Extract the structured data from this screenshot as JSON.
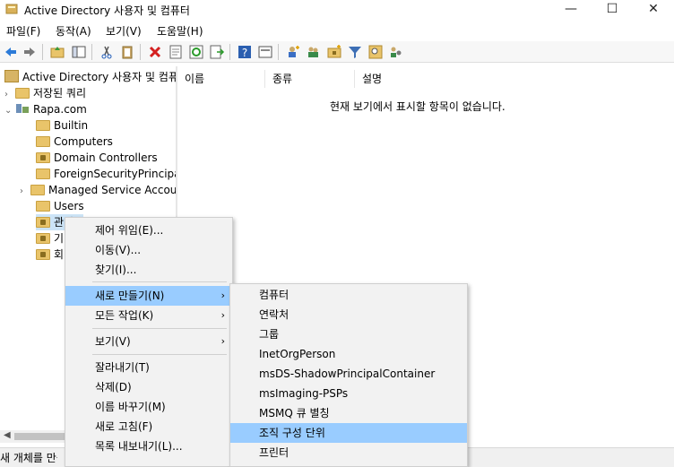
{
  "window": {
    "title": "Active Directory 사용자 및 컴퓨터"
  },
  "menu": [
    "파일(F)",
    "동작(A)",
    "보기(V)",
    "도움말(H)"
  ],
  "tree": {
    "root_label": "Active Directory 사용자 및 컴퓨",
    "saved_queries": "저장된 쿼리",
    "domain": "Rapa.com",
    "children": [
      "Builtin",
      "Computers",
      "Domain Controllers",
      "ForeignSecurityPrincipal",
      "Managed Service Accou",
      "Users",
      "관리부",
      "기",
      "회"
    ]
  },
  "list": {
    "columns": [
      "이름",
      "종류",
      "설명"
    ],
    "empty_message": "현재 보기에서 표시할 항목이 없습니다."
  },
  "context_menu": {
    "items": [
      "제어 위임(E)...",
      "이동(V)...",
      "찾기(I)...",
      "새로 만들기(N)",
      "모든 작업(K)",
      "보기(V)",
      "잘라내기(T)",
      "삭제(D)",
      "이름 바꾸기(M)",
      "새로 고침(F)",
      "목록 내보내기(L)..."
    ],
    "submenu_arrow": "›"
  },
  "submenu": {
    "items": [
      "컴퓨터",
      "연락처",
      "그룹",
      "InetOrgPerson",
      "msDS-ShadowPrincipalContainer",
      "msImaging-PSPs",
      "MSMQ 큐 별칭",
      "조직 구성 단위",
      "프린터"
    ]
  },
  "statusbar": {
    "text": "새 개체를 만듭니다."
  },
  "colors": {
    "highlight": "#99ccff",
    "menu_bg": "#f2f2f2"
  }
}
